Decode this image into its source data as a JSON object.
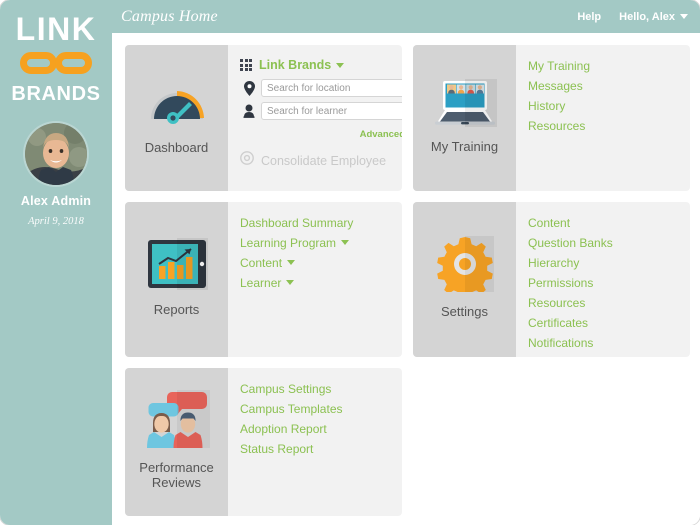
{
  "brand": {
    "logo_line1": "LINK",
    "logo_line2": "BRANDS",
    "chain_icon": "chain-link-icon"
  },
  "sidebar": {
    "user_name": "Alex Admin",
    "date": "April 9, 2018",
    "avatar_icon": "user-avatar-photo"
  },
  "header": {
    "title": "Campus Home",
    "help_label": "Help",
    "user_menu_label": "Hello, Alex",
    "caret_icon": "chevron-down-icon"
  },
  "cards": {
    "dashboard": {
      "label": "Dashboard",
      "icon": "speedometer-gauge-icon",
      "brand_selector": {
        "grid_icon": "grid-apps-icon",
        "label": "Link Brands",
        "caret_icon": "chevron-down-icon"
      },
      "location_search": {
        "icon": "map-pin-icon",
        "placeholder": "Search for location",
        "value": ""
      },
      "learner_search": {
        "icon": "person-icon",
        "placeholder": "Search for learner",
        "value": ""
      },
      "advanced_label": "Advanced",
      "consolidate": {
        "icon": "circle-smiley-icon",
        "label": "Consolidate Employee"
      }
    },
    "my_training": {
      "label": "My Training",
      "icon": "laptop-people-icon",
      "links": [
        {
          "label": "My Training"
        },
        {
          "label": "Messages"
        },
        {
          "label": "History"
        },
        {
          "label": "Resources"
        }
      ]
    },
    "reports": {
      "label": "Reports",
      "icon": "tablet-chart-icon",
      "links": [
        {
          "label": "Dashboard Summary",
          "caret": false
        },
        {
          "label": "Learning Program",
          "caret": true
        },
        {
          "label": "Content",
          "caret": true
        },
        {
          "label": "Learner",
          "caret": true
        }
      ]
    },
    "settings": {
      "label": "Settings",
      "icon": "gear-icon",
      "links": [
        {
          "label": "Content"
        },
        {
          "label": "Question Banks"
        },
        {
          "label": "Hierarchy"
        },
        {
          "label": "Permissions"
        },
        {
          "label": "Resources"
        },
        {
          "label": "Certificates"
        },
        {
          "label": "Notifications"
        }
      ]
    },
    "performance_reviews": {
      "label_line1": "Performance",
      "label_line2": "Reviews",
      "icon": "two-people-speech-bubbles-icon",
      "links": [
        {
          "label": "Campus Settings"
        },
        {
          "label": "Campus Templates"
        },
        {
          "label": "Adoption Report"
        },
        {
          "label": "Status Report"
        }
      ]
    }
  },
  "colors": {
    "sidebar_teal": "#a3c9c5",
    "link_green": "#8cc152",
    "icon_pane_gray": "#d4d4d4",
    "card_body_gray": "#f2f2f2",
    "accent_orange": "#f7a325",
    "text_dark": "#555555"
  }
}
